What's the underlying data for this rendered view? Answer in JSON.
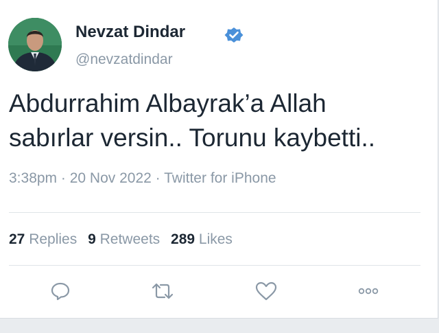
{
  "author": {
    "name": "Nevzat Dindar",
    "handle": "@nevzatdindar",
    "verified_icon": "verified-badge-icon"
  },
  "tweet": {
    "line1": "Abdurrahim Albayrak’a Allah",
    "line2": "sabırlar versin.. Torunu kaybetti..",
    "time": "3:38pm",
    "sep1": "·",
    "date": "20 Nov 2022",
    "sep2": "·",
    "source": "Twitter for iPhone"
  },
  "stats": {
    "replies_count": "27",
    "replies_label": "Replies",
    "retweets_count": "9",
    "retweets_label": "Retweets",
    "likes_count": "289",
    "likes_label": "Likes"
  },
  "actions": {
    "reply_icon": "reply-icon",
    "retweet_icon": "retweet-icon",
    "like_icon": "like-icon",
    "more_icon": "more-icon"
  },
  "colors": {
    "text": "#1c2733",
    "muted": "#8a98a6",
    "verified": "#4a90d9",
    "icon": "#8a98a6"
  }
}
